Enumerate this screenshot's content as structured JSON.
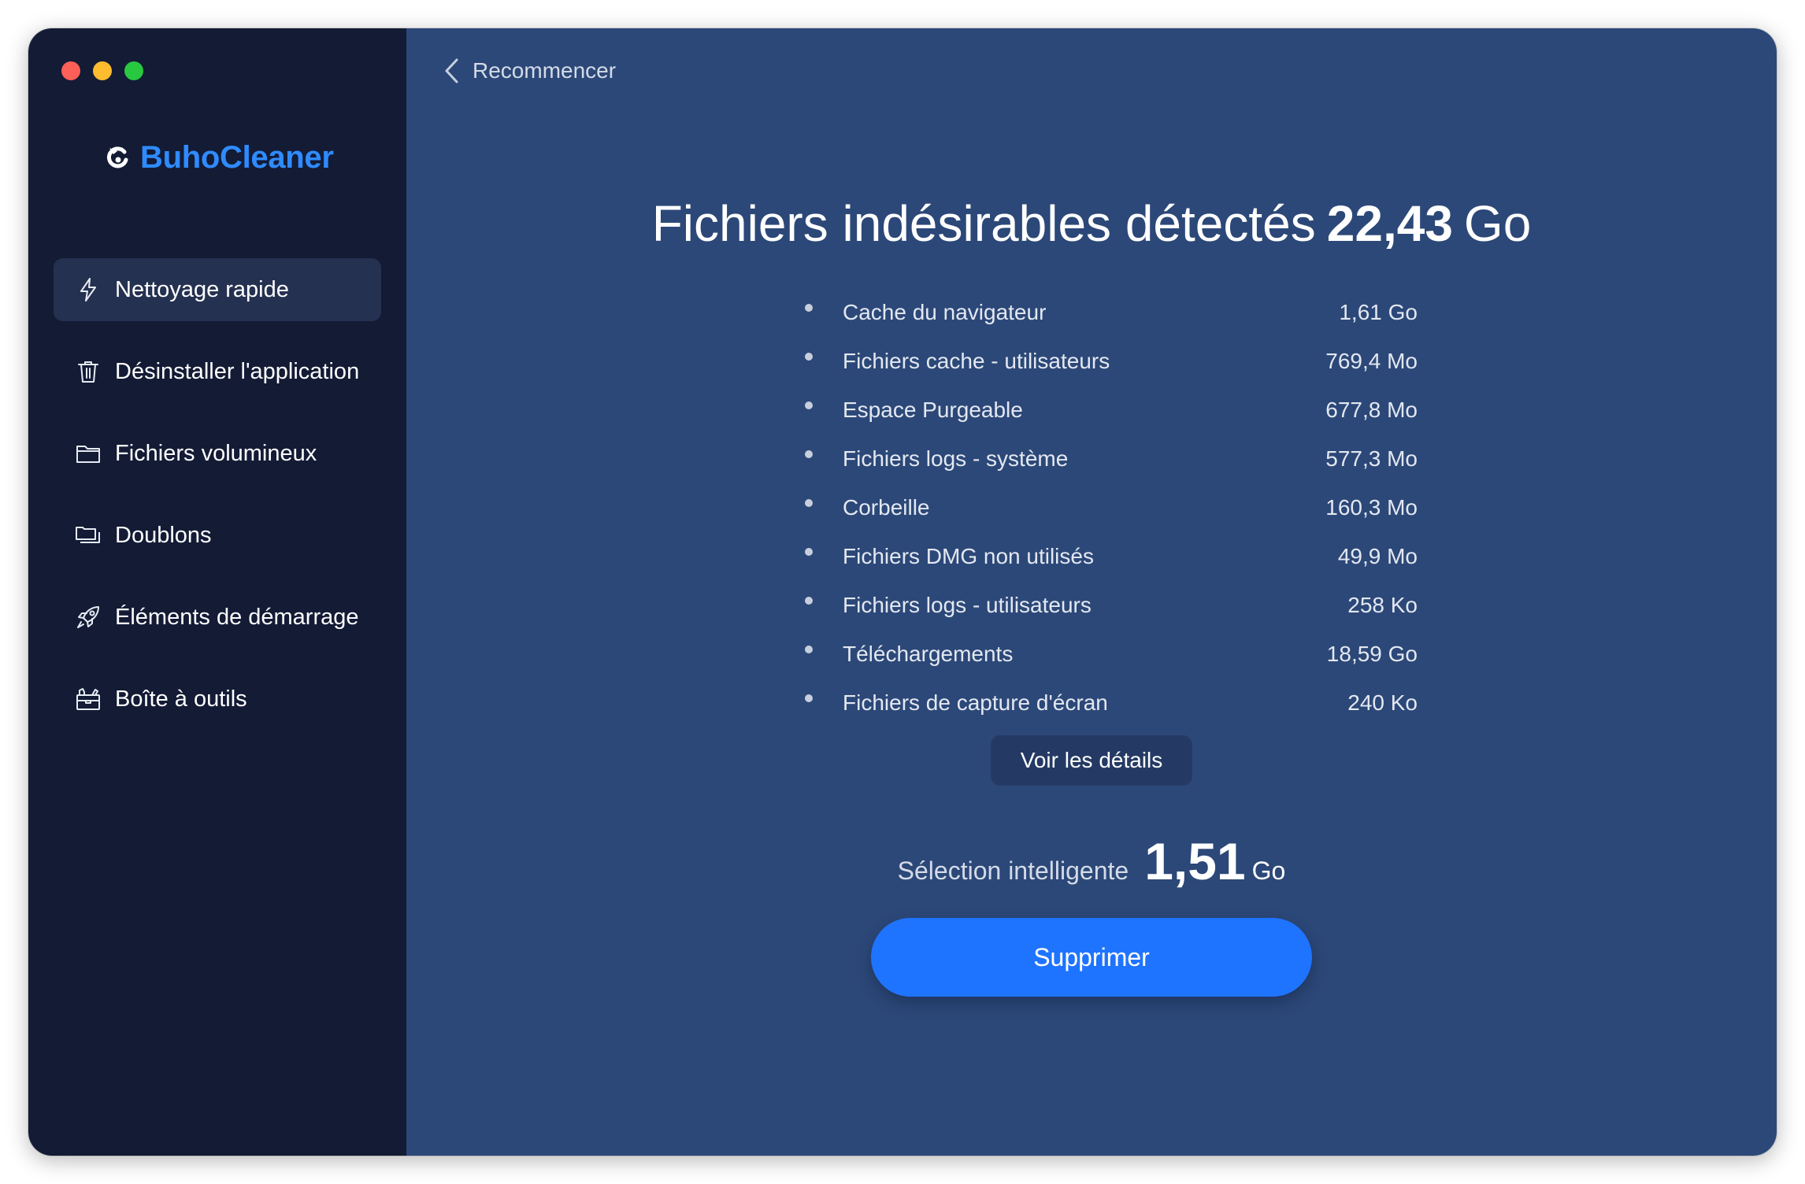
{
  "app": {
    "name": "BuhoCleaner",
    "brand_color": "#2f8bff"
  },
  "window_controls": [
    "close",
    "minimize",
    "zoom"
  ],
  "sidebar": {
    "items": [
      {
        "label": "Nettoyage rapide",
        "icon": "lightning-icon",
        "active": true
      },
      {
        "label": "Désinstaller l'application",
        "icon": "trash-icon",
        "active": false
      },
      {
        "label": "Fichiers volumineux",
        "icon": "folder-icon",
        "active": false
      },
      {
        "label": "Doublons",
        "icon": "duplicate-folders-icon",
        "active": false
      },
      {
        "label": "Éléments de démarrage",
        "icon": "rocket-icon",
        "active": false
      },
      {
        "label": "Boîte à outils",
        "icon": "toolbox-icon",
        "active": false
      }
    ]
  },
  "header": {
    "back_label": "Recommencer"
  },
  "summary": {
    "title_prefix": "Fichiers indésirables détectés",
    "total_amount": "22,43",
    "total_unit": "Go"
  },
  "junk_items": [
    {
      "name": "Cache du navigateur",
      "size": "1,61 Go"
    },
    {
      "name": "Fichiers cache - utilisateurs",
      "size": "769,4 Mo"
    },
    {
      "name": "Espace Purgeable",
      "size": "677,8 Mo"
    },
    {
      "name": "Fichiers logs - système",
      "size": "577,3 Mo"
    },
    {
      "name": "Corbeille",
      "size": "160,3 Mo"
    },
    {
      "name": "Fichiers DMG non utilisés",
      "size": "49,9 Mo"
    },
    {
      "name": "Fichiers logs - utilisateurs",
      "size": "258 Ko"
    },
    {
      "name": "Téléchargements",
      "size": "18,59 Go"
    },
    {
      "name": "Fichiers de capture d'écran",
      "size": "240 Ko"
    }
  ],
  "actions": {
    "details_label": "Voir les détails",
    "delete_label": "Supprimer",
    "delete_color": "#1f74ff"
  },
  "smart_selection": {
    "label": "Sélection intelligente",
    "value": "1,51",
    "unit": "Go"
  }
}
